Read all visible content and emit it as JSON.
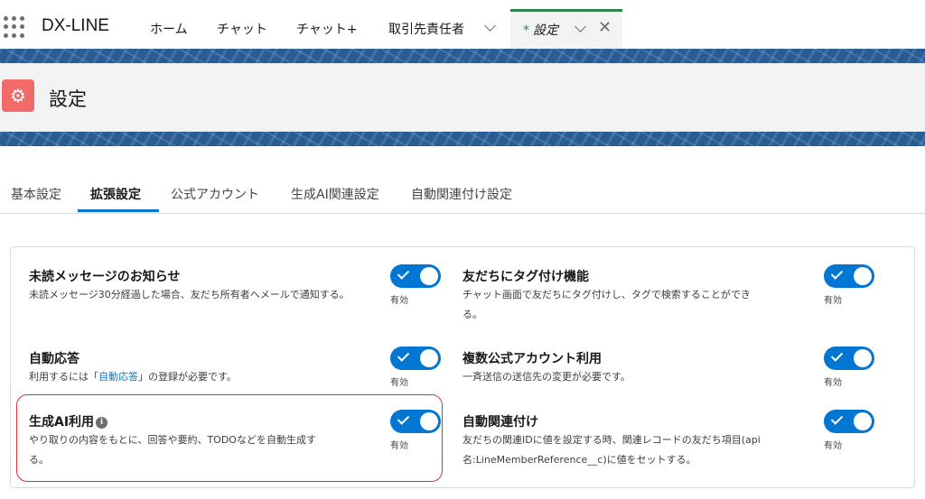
{
  "app": {
    "name": "DX-LINE"
  },
  "nav": {
    "items": [
      "ホーム",
      "チャット",
      "チャット+",
      "取引先責任者"
    ],
    "active_tab": {
      "modified_marker": "*",
      "label": "設定"
    }
  },
  "header": {
    "title": "設定"
  },
  "subtabs": [
    "基本設定",
    "拡張設定",
    "公式アカウント",
    "生成AI関連設定",
    "自動関連付け設定"
  ],
  "settings": {
    "unread": {
      "title": "未読メッセージのお知らせ",
      "desc": "未読メッセージ30分経過した場合、友だち所有者へメールで通知する。",
      "state": "有効"
    },
    "auto_reply": {
      "title": "自動応答",
      "desc_before": "利用するには「",
      "desc_link": "自動応答",
      "desc_after": "」の登録が必要です。",
      "state": "有効"
    },
    "gen_ai": {
      "title": "生成AI利用",
      "info": "i",
      "desc": "やり取りの内容をもとに、回答や要約、TODOなどを自動生成する。",
      "state": "有効"
    },
    "tagging": {
      "title": "友だちにタグ付け機能",
      "desc": "チャット画面で友だちにタグ付けし、タグで検索することができる。",
      "state": "有効"
    },
    "multi_account": {
      "title": "複数公式アカウント利用",
      "desc": "一斉送信の送信先の変更が必要です。",
      "state": "有効"
    },
    "auto_link": {
      "title": "自動関連付け",
      "desc": "友だちの関連IDに値を設定する時、関連レコードの友だち項目(api名:LineMemberReference__c)に値をセットする。",
      "state": "有効"
    }
  }
}
